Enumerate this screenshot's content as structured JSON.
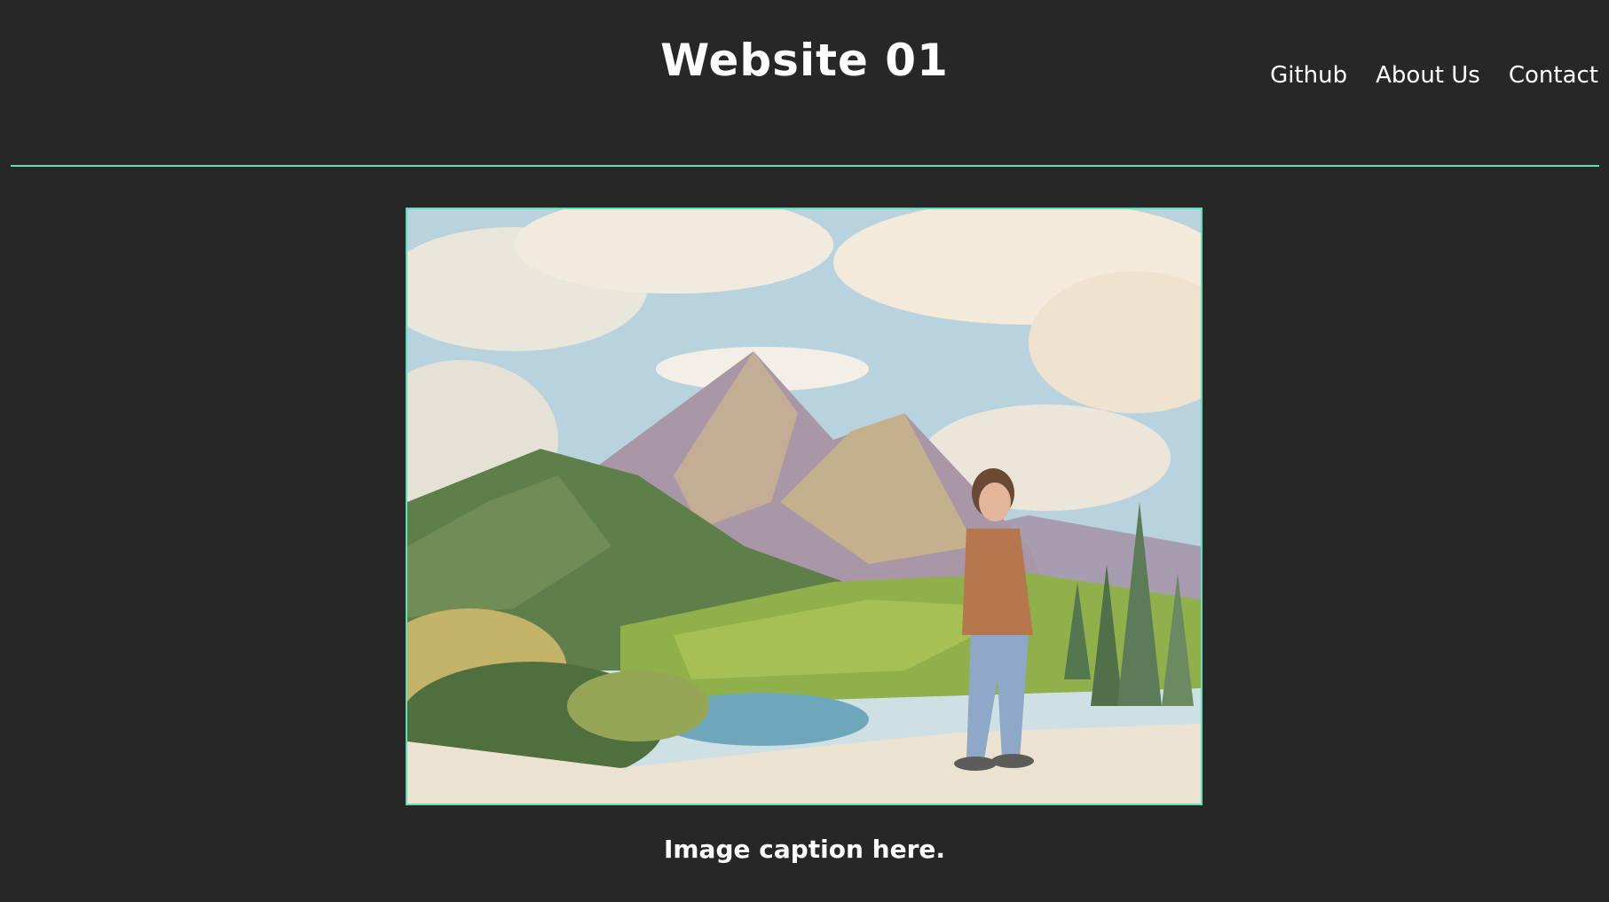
{
  "header": {
    "title": "Website 01",
    "nav": [
      {
        "label": "Github"
      },
      {
        "label": "About Us"
      },
      {
        "label": "Contact"
      }
    ]
  },
  "main": {
    "caption": "Image caption here."
  },
  "colors": {
    "background": "#272727",
    "accent": "#63dcb8",
    "text": "#ffffff"
  }
}
